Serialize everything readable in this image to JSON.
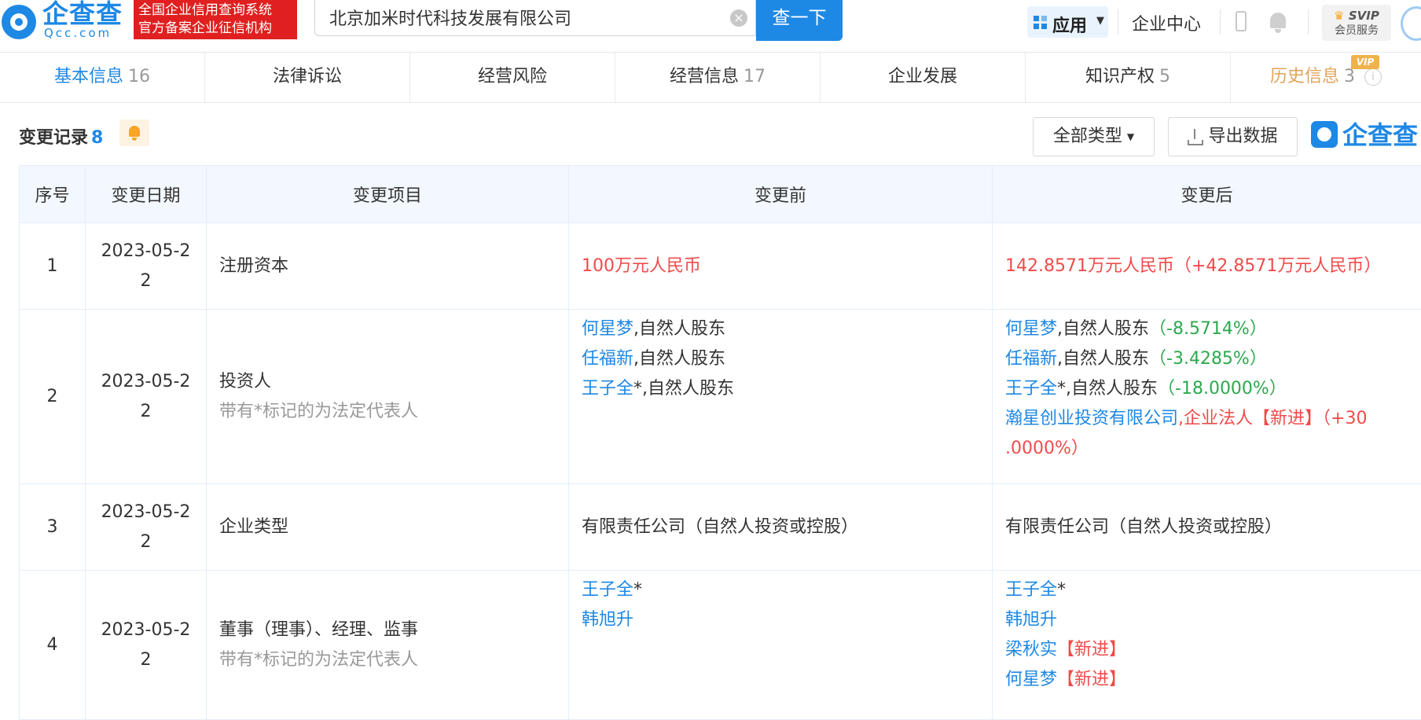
{
  "header": {
    "logo_text": "企查查",
    "logo_domain": "Qcc.com",
    "badge_line1": "全国企业信用查询系统",
    "badge_line2": "官方备案企业征信机构",
    "search_value": "北京加米时代科技发展有限公司",
    "clear_icon": "×",
    "search_button": "查一下",
    "app_menu": "应用",
    "enterprise_center": "企业中心",
    "svip_top": "SVIP",
    "svip_bottom": "会员服务"
  },
  "tabs": [
    {
      "label": "基本信息",
      "count": "16",
      "active": true
    },
    {
      "label": "法律诉讼",
      "count": ""
    },
    {
      "label": "经营风险",
      "count": ""
    },
    {
      "label": "经营信息",
      "count": "17"
    },
    {
      "label": "企业发展",
      "count": ""
    },
    {
      "label": "知识产权",
      "count": "5"
    },
    {
      "label": "历史信息",
      "count": "3",
      "vip": "VIP"
    }
  ],
  "section": {
    "title": "变更记录",
    "count": "8",
    "type_button": "全部类型",
    "export_button": "导出数据",
    "watermark_logo": "企查查"
  },
  "table": {
    "headers": [
      "序号",
      "变更日期",
      "变更项目",
      "变更前",
      "变更后"
    ],
    "rows": [
      {
        "index": "1",
        "date_a": "2023-05-2",
        "date_b": "2",
        "item": "注册资本",
        "item_note": "",
        "before": "100万元人民币",
        "after": "142.8571万元人民币（+42.8571万元人民币）"
      },
      {
        "index": "2",
        "date_a": "2023-05-2",
        "date_b": "2",
        "item": "投资人",
        "item_note": "带有*标记的为法定代表人",
        "before": [
          {
            "name": "何星梦",
            "rest": ",自然人股东"
          },
          {
            "name": "任福新",
            "rest": ",自然人股东"
          },
          {
            "name": "王子全",
            "rest": "*,自然人股东"
          }
        ],
        "after": [
          {
            "name": "何星梦",
            "rest": ",自然人股东",
            "change": "（-8.5714%）"
          },
          {
            "name": "任福新",
            "rest": ",自然人股东",
            "change": "（-3.4285%）"
          },
          {
            "name": "王子全",
            "rest": "*,自然人股东",
            "change": "（-18.0000%）"
          },
          {
            "name": "瀚星创业投资有限公司",
            "rest": ",企业法人【新进】（+30",
            "rest2": ".0000%）"
          }
        ]
      },
      {
        "index": "3",
        "date_a": "2023-05-2",
        "date_b": "2",
        "item": "企业类型",
        "item_note": "",
        "before": "有限责任公司（自然人投资或控股）",
        "after": "有限责任公司（自然人投资或控股）"
      },
      {
        "index": "4",
        "date_a": "2023-05-2",
        "date_b": "2",
        "item": "董事（理事）、经理、监事",
        "item_note": "带有*标记的为法定代表人",
        "before": [
          {
            "name": "王子全",
            "rest": "*"
          },
          {
            "name": "韩旭升",
            "rest": ""
          }
        ],
        "after": [
          {
            "name": "王子全",
            "rest": "*"
          },
          {
            "name": "韩旭升",
            "rest": ""
          },
          {
            "name": "梁秋实",
            "rest": "【新进】"
          },
          {
            "name": "何星梦",
            "rest": "【新进】"
          }
        ]
      }
    ]
  },
  "colors": {
    "brand_blue": "#1e88e5",
    "red": "#f04b4b",
    "green": "#2ca94f",
    "vip_gold": "#f0b24a"
  }
}
